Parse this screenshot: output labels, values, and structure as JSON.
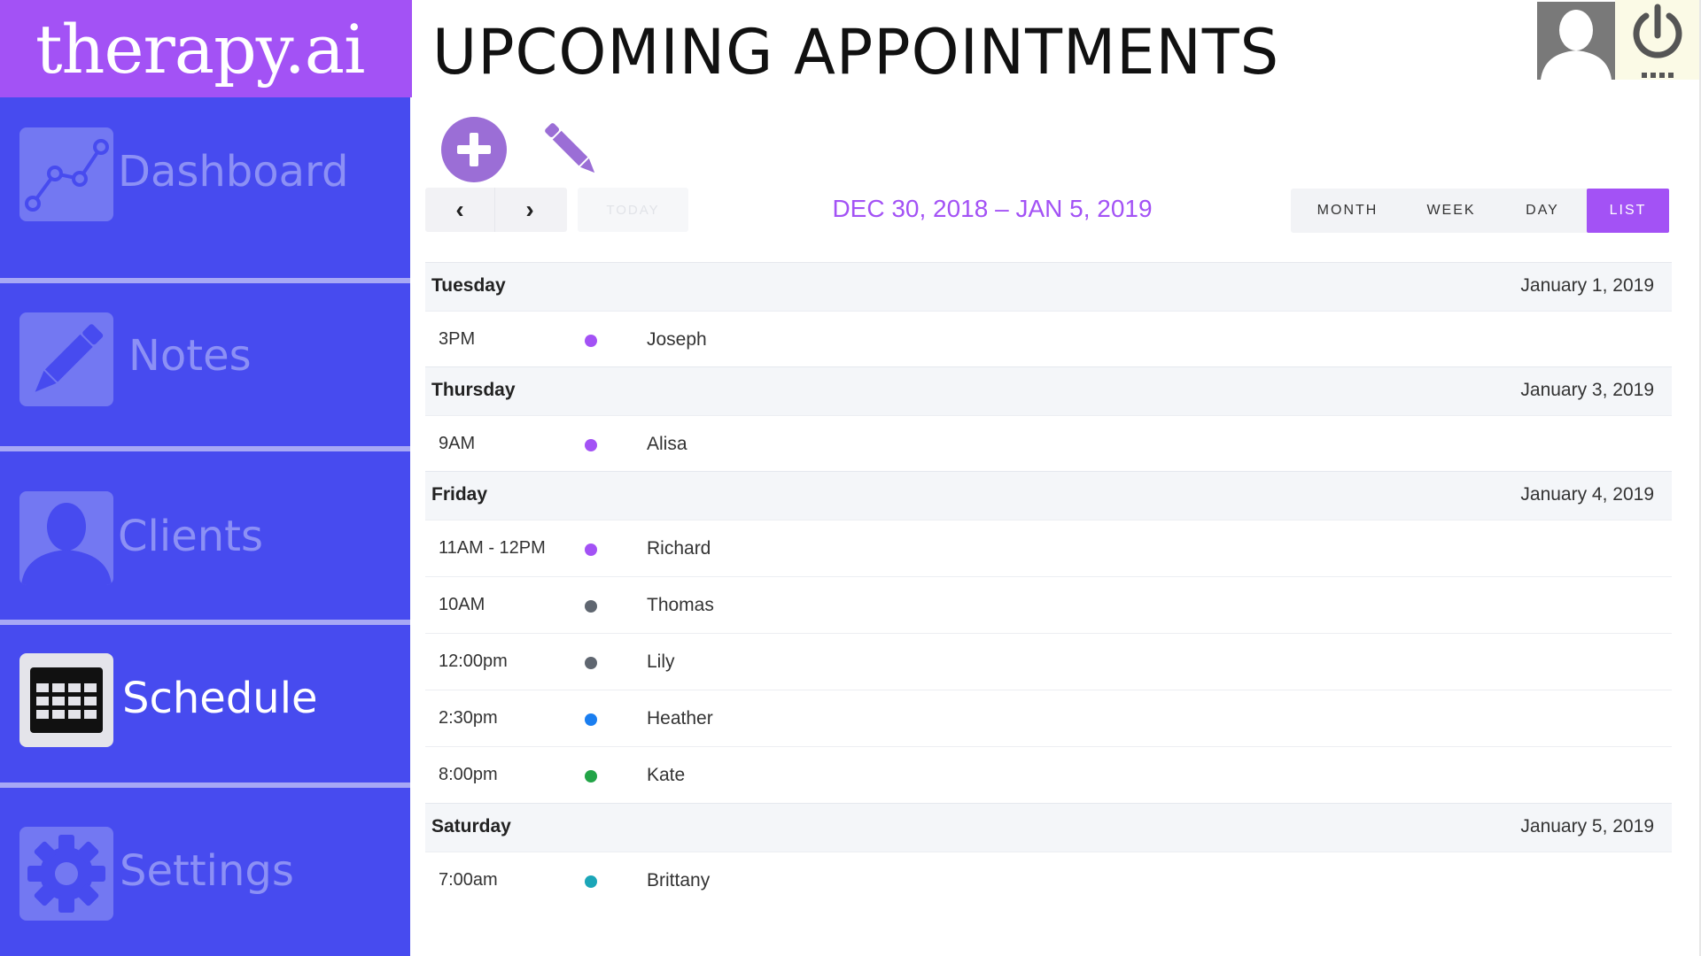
{
  "app": {
    "logo": "therapy.ai"
  },
  "sidebar": {
    "items": [
      {
        "label": "Dashboard",
        "icon": "chart-line-icon",
        "active": false
      },
      {
        "label": "Notes",
        "icon": "pencil-icon",
        "active": false
      },
      {
        "label": "Clients",
        "icon": "person-icon",
        "active": false
      },
      {
        "label": "Schedule",
        "icon": "calendar-grid-icon",
        "active": true
      },
      {
        "label": "Settings",
        "icon": "gear-icon",
        "active": false
      }
    ]
  },
  "header": {
    "title": "UPCOMING APPOINTMENTS",
    "avatar_icon": "avatar-icon",
    "power_icon": "power-icon"
  },
  "toolbar": {
    "add_icon": "plus-circle-icon",
    "edit_icon": "pencil-icon"
  },
  "calendar": {
    "prev": "‹",
    "next": "›",
    "today": "TODAY",
    "range": "DEC 30, 2018 – JAN 5, 2019",
    "views": [
      "MONTH",
      "WEEK",
      "DAY",
      "LIST"
    ],
    "active_view": "LIST",
    "days": [
      {
        "name": "Tuesday",
        "date": "January 1, 2019",
        "events": [
          {
            "time": "3PM",
            "name": "Joseph",
            "color": "#a352f5"
          }
        ]
      },
      {
        "name": "Thursday",
        "date": "January 3, 2019",
        "events": [
          {
            "time": "9AM",
            "name": "Alisa",
            "color": "#a352f5"
          }
        ]
      },
      {
        "name": "Friday",
        "date": "January 4, 2019",
        "events": [
          {
            "time": "11AM - 12PM",
            "name": "Richard",
            "color": "#a352f5"
          },
          {
            "time": "10AM",
            "name": "Thomas",
            "color": "#5f6670"
          },
          {
            "time": "12:00pm",
            "name": "Lily",
            "color": "#5f6670"
          },
          {
            "time": "2:30pm",
            "name": "Heather",
            "color": "#1a7ef0"
          },
          {
            "time": "8:00pm",
            "name": "Kate",
            "color": "#22a447"
          }
        ]
      },
      {
        "name": "Saturday",
        "date": "January 5, 2019",
        "events": [
          {
            "time": "7:00am",
            "name": "Brittany",
            "color": "#1ba6b8"
          }
        ]
      }
    ]
  },
  "colors": {
    "accent": "#a352f5",
    "sidebar": "#474bef",
    "sidebar_text": "#8c90f5"
  }
}
